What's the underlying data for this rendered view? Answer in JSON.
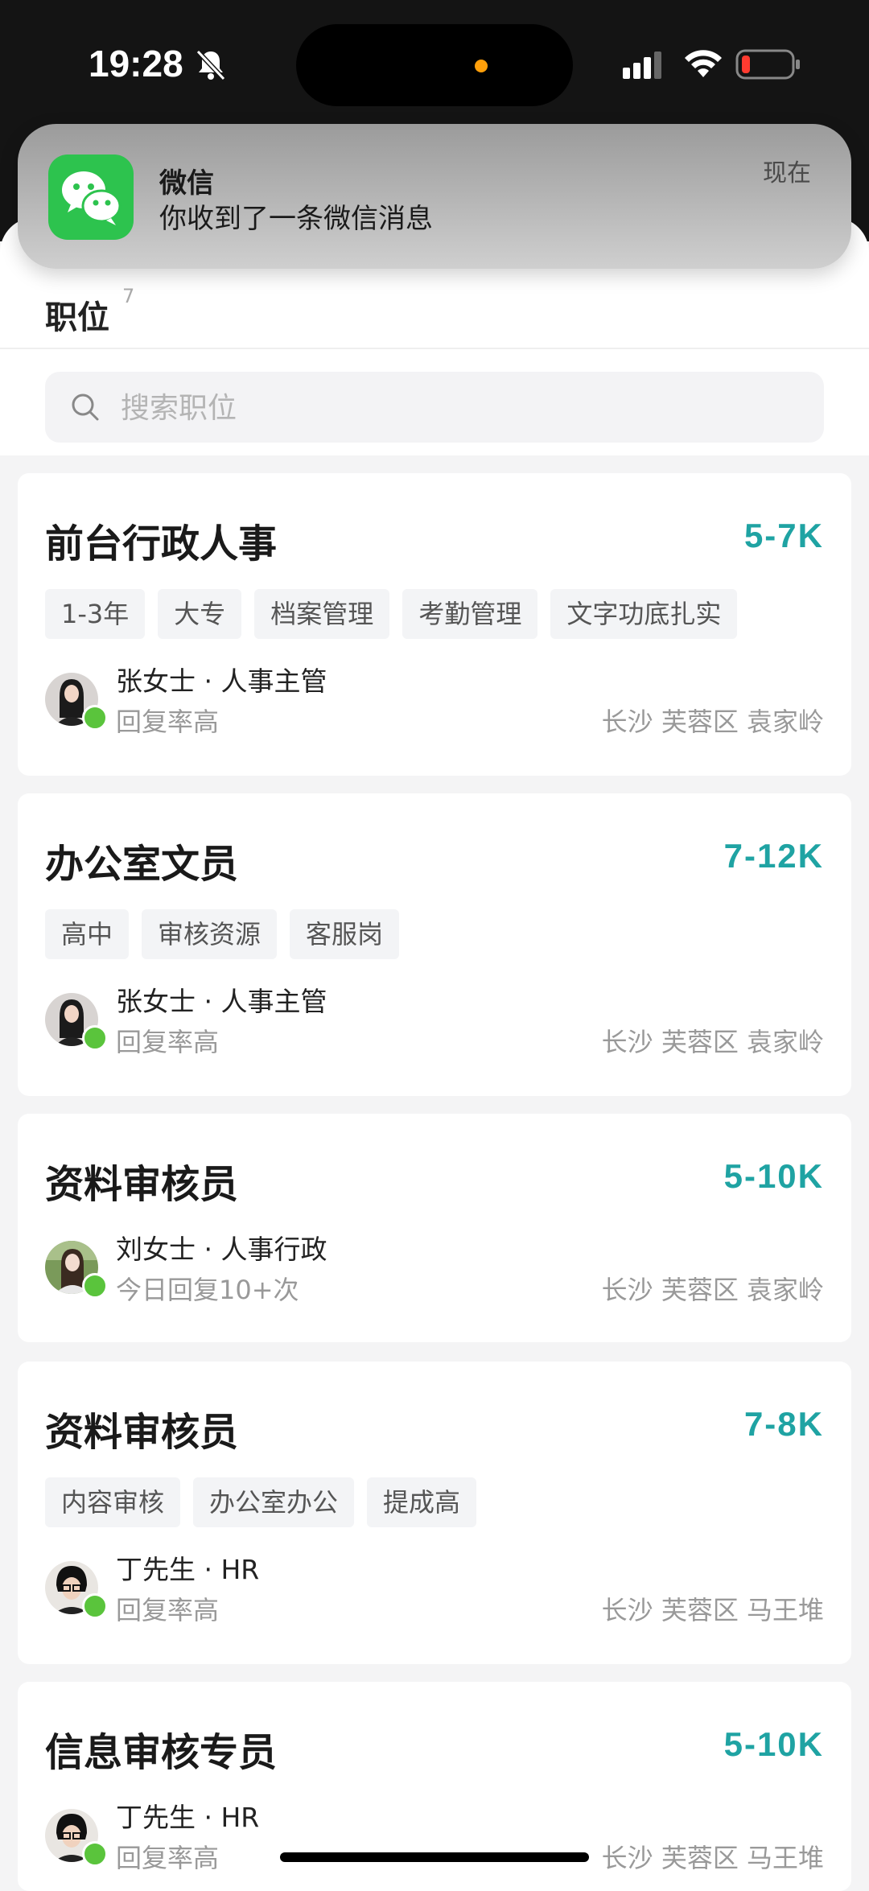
{
  "status_bar": {
    "time": "19:28"
  },
  "notification": {
    "app": "微信",
    "message": "你收到了一条微信消息",
    "time": "现在"
  },
  "header": {
    "title": "职位",
    "count": "7"
  },
  "search": {
    "placeholder": "搜索职位"
  },
  "jobs": [
    {
      "title": "前台行政人事",
      "salary": "5-7K",
      "tags": [
        "1-3年",
        "大专",
        "档案管理",
        "考勤管理",
        "文字功底扎实"
      ],
      "recruiter": "张女士 · 人事主管",
      "reply": "回复率高",
      "location": "长沙 芙蓉区 袁家岭"
    },
    {
      "title": "办公室文员",
      "salary": "7-12K",
      "tags": [
        "高中",
        "审核资源",
        "客服岗"
      ],
      "recruiter": "张女士 · 人事主管",
      "reply": "回复率高",
      "location": "长沙 芙蓉区 袁家岭"
    },
    {
      "title": "资料审核员",
      "salary": "5-10K",
      "tags": [],
      "recruiter": "刘女士 · 人事行政",
      "reply": "今日回复10+次",
      "location": "长沙 芙蓉区 袁家岭"
    },
    {
      "title": "资料审核员",
      "salary": "7-8K",
      "tags": [
        "内容审核",
        "办公室办公",
        "提成高"
      ],
      "recruiter": "丁先生 · HR",
      "reply": "回复率高",
      "location": "长沙 芙蓉区 马王堆"
    },
    {
      "title": "信息审核专员",
      "salary": "5-10K",
      "tags": [],
      "recruiter": "丁先生 · HR",
      "reply": "回复率高",
      "location": "长沙 芙蓉区 马王堆"
    }
  ]
}
